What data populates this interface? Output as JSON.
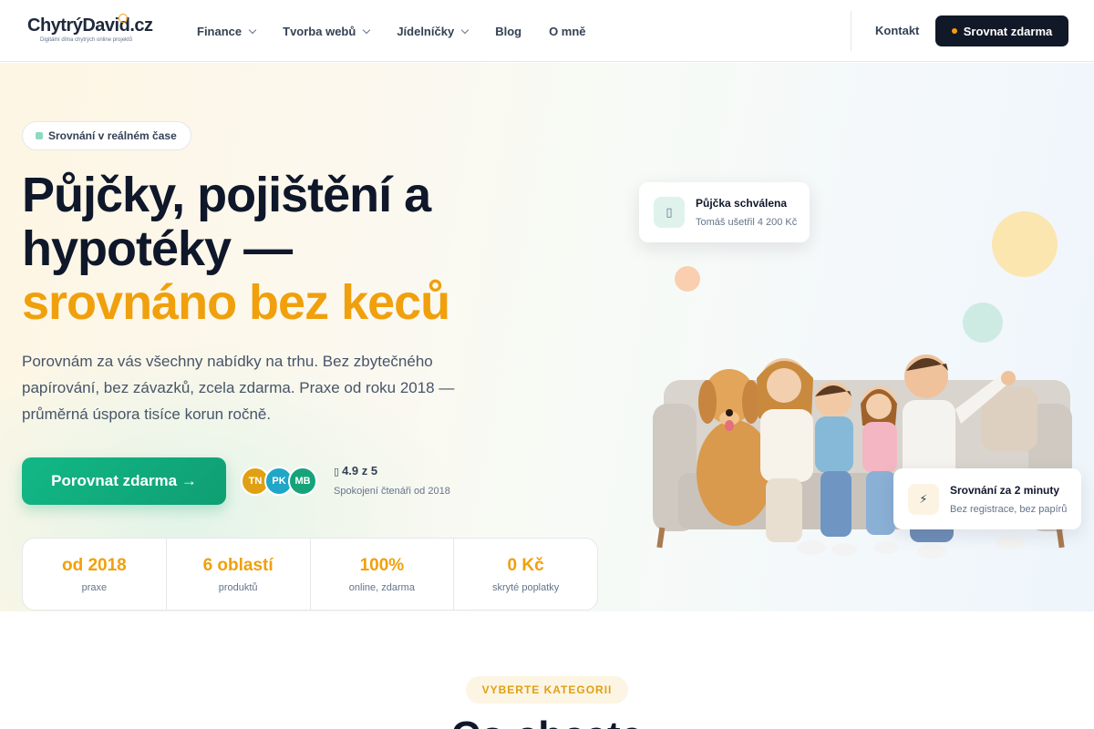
{
  "header": {
    "logo_text": "ChytrýDavid.cz",
    "logo_tagline": "Digitální dílna chytrých online projektů",
    "nav": [
      {
        "label": "Finance"
      },
      {
        "label": "Tvorba webů"
      },
      {
        "label": "Jídelníčky"
      },
      {
        "label": "Blog"
      },
      {
        "label": "O mně"
      }
    ],
    "contact_label": "Kontakt",
    "cta_label": "Srovnat zdarma"
  },
  "hero": {
    "badge": "Srovnání v reálném čase",
    "headline_line1": "Půjčky, pojištění a",
    "headline_line2": "hypotéky —",
    "headline_line3": "srovnáno bez keců",
    "lede": "Porovnám za vás všechny nabídky na trhu. Bez zbytečného papírování, bez závazků, zcela zdarma. Praxe od roku 2018 — průměrná úspora tisíce korun ročně.",
    "cta_label": "Porovnat zdarma →",
    "avatars": [
      "TN",
      "PK",
      "MB"
    ],
    "rating": "4.9 z 5",
    "rating_sub": "Spokojení čtenáři od 2018",
    "stats": [
      {
        "value": "od 2018",
        "label": "praxe"
      },
      {
        "value": "6 oblastí",
        "label": "produktů"
      },
      {
        "value": "100%",
        "label": "online, zdarma"
      },
      {
        "value": "0 Kč",
        "label": "skryté poplatky"
      }
    ],
    "notif_approved": {
      "title": "Půjčka schválena",
      "sub": "Tomáš ušetřil 4 200 Kč"
    },
    "notif_fast": {
      "title": "Srovnání za 2 minuty",
      "sub": "Bez registrace, bez papírů"
    }
  },
  "section": {
    "pill": "VYBERTE KATEGORII",
    "title_partial": "Co chcete"
  },
  "colors": {
    "accent_orange": "#f0a00c",
    "accent_green": "#12b886",
    "dark": "#111827"
  }
}
